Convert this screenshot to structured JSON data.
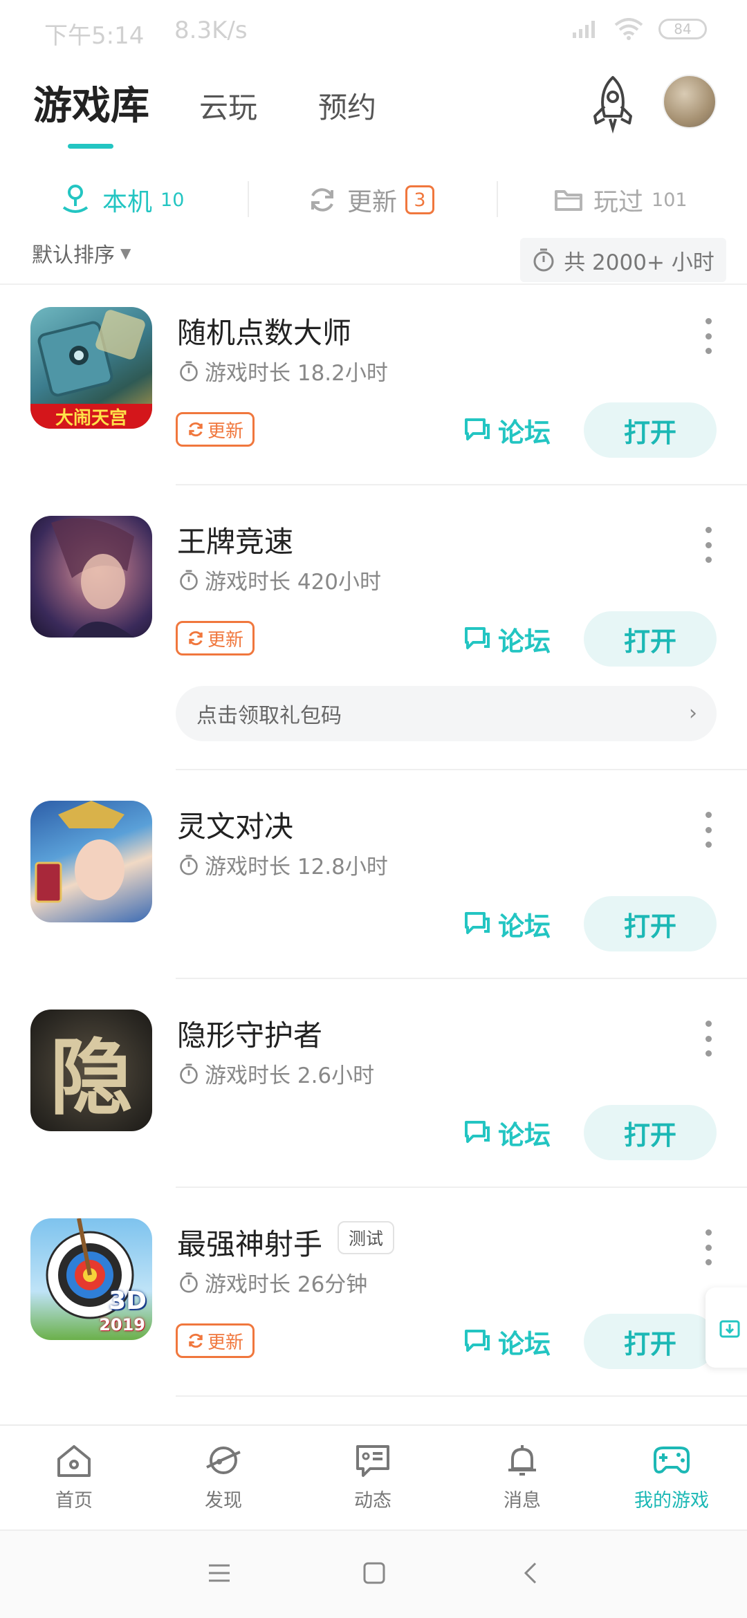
{
  "status_bar": {
    "time": "下午5:14",
    "speed": "8.3K/s",
    "battery": "84"
  },
  "top_tabs": {
    "active": "游戏库",
    "cloud": "云玩",
    "reserve": "预约"
  },
  "sub_tabs": {
    "local": {
      "label": "本机",
      "count": "10"
    },
    "update": {
      "label": "更新",
      "count": "3"
    },
    "played": {
      "label": "玩过",
      "count": "101"
    }
  },
  "sort": {
    "label": "默认排序"
  },
  "total_time": "共 2000+ 小时",
  "accent": "#23c5c2",
  "update_color": "#f0773d",
  "games": [
    {
      "name": "随机点数大师",
      "playtime": "游戏时长 18.2小时",
      "update": "更新",
      "forum": "论坛",
      "open": "打开",
      "icon_caption": "大闹天宫"
    },
    {
      "name": "王牌竞速",
      "playtime": "游戏时长 420小时",
      "update": "更新",
      "forum": "论坛",
      "open": "打开",
      "gift": "点击领取礼包码"
    },
    {
      "name": "灵文对决",
      "playtime": "游戏时长 12.8小时",
      "forum": "论坛",
      "open": "打开"
    },
    {
      "name": "隐形守护者",
      "playtime": "游戏时长 2.6小时",
      "forum": "论坛",
      "open": "打开",
      "icon_glyph": "隐"
    },
    {
      "name": "最强神射手",
      "tag": "测试",
      "playtime": "游戏时长 26分钟",
      "update": "更新",
      "forum": "论坛",
      "open": "打开",
      "icon_caption": "3D",
      "icon_year": "2019"
    }
  ],
  "bottom_nav": [
    {
      "label": "首页",
      "icon": "home-icon"
    },
    {
      "label": "发现",
      "icon": "planet-icon"
    },
    {
      "label": "动态",
      "icon": "message-card-icon"
    },
    {
      "label": "消息",
      "icon": "bell-icon"
    },
    {
      "label": "我的游戏",
      "icon": "gamepad-icon",
      "active": true
    }
  ]
}
